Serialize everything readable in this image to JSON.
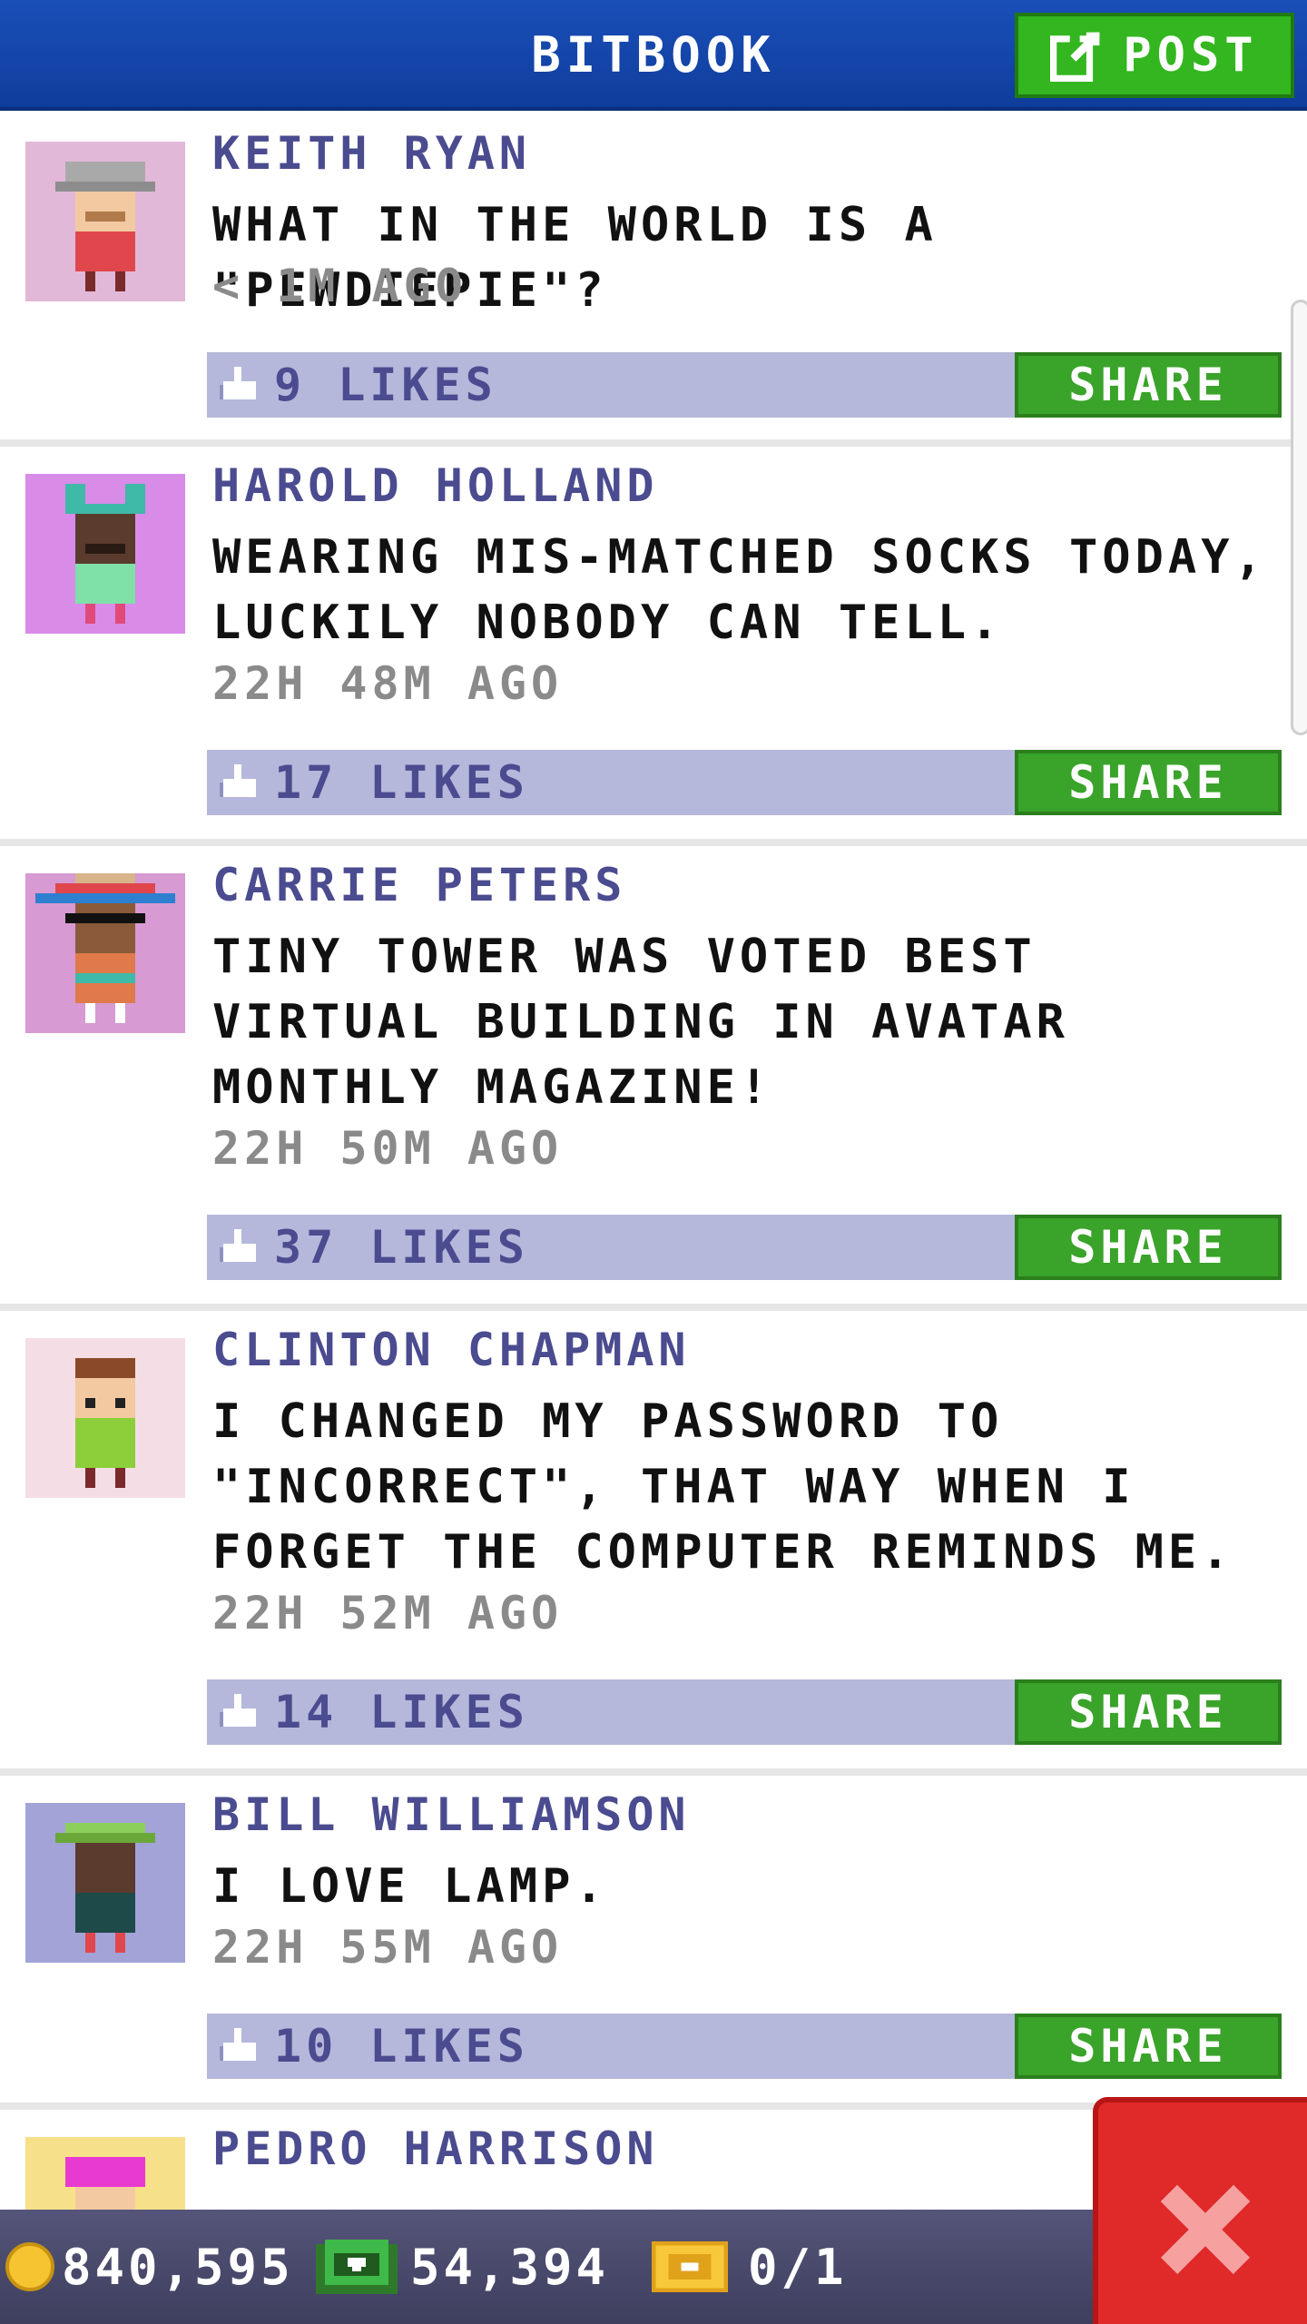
{
  "header": {
    "title": "BITBOOK",
    "post_label": "POST"
  },
  "colors": {
    "header_blue": "#1a4fb8",
    "green": "#3aa32a",
    "likes_bar": "#b5b8da",
    "name_purple": "#4b4b90",
    "close_red": "#e02a2a"
  },
  "posts": [
    {
      "name": "KEITH RYAN",
      "message": "WHAT IN THE WORLD IS A \"PEWDIEPIE\"?",
      "time": "< 1M AGO",
      "likes": "9 LIKES",
      "share_label": "SHARE"
    },
    {
      "name": "HAROLD HOLLAND",
      "message": "WEARING MIS-MATCHED SOCKS TODAY, LUCKILY NOBODY CAN TELL.",
      "time": "22H 48M AGO",
      "likes": "17 LIKES",
      "share_label": "SHARE"
    },
    {
      "name": "CARRIE PETERS",
      "message": "TINY TOWER WAS VOTED BEST VIRTUAL BUILDING IN AVATAR MONTHLY MAGAZINE!",
      "time": "22H 50M AGO",
      "likes": "37 LIKES",
      "share_label": "SHARE"
    },
    {
      "name": "CLINTON CHAPMAN",
      "message": "I CHANGED MY PASSWORD TO \"INCORRECT\", THAT WAY WHEN I FORGET THE COMPUTER REMINDS ME.",
      "time": "22H 52M AGO",
      "likes": "14 LIKES",
      "share_label": "SHARE"
    },
    {
      "name": "BILL WILLIAMSON",
      "message": "I LOVE LAMP.",
      "time": "22H 55M AGO",
      "likes": "10 LIKES",
      "share_label": "SHARE"
    },
    {
      "name": "PEDRO HARRISON"
    }
  ],
  "status": {
    "coins": "840,595",
    "bux": "54,394",
    "tickets": "0/1"
  }
}
